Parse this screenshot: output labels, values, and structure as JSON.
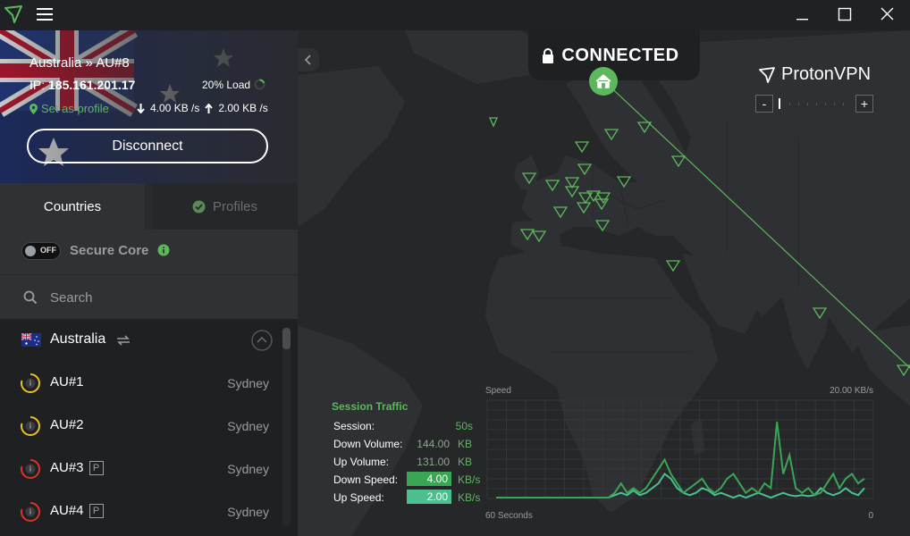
{
  "window": {
    "controls": [
      "minimize",
      "maximize",
      "close"
    ]
  },
  "connection": {
    "server": "Australia » AU#8",
    "ip_label": "IP:",
    "ip": "185.161.201.17",
    "load": "20% Load",
    "set_profile": "Set as profile",
    "down_speed": "4.00 KB /s",
    "up_speed": "2.00 KB /s",
    "disconnect_label": "Disconnect"
  },
  "tabs": {
    "countries": "Countries",
    "profiles": "Profiles"
  },
  "secure_core": {
    "toggle": "OFF",
    "label": "Secure Core"
  },
  "search": {
    "placeholder": "Search"
  },
  "country": {
    "name": "Australia"
  },
  "servers": [
    {
      "name": "AU#1",
      "city": "Sydney",
      "plus": false,
      "color": "#e5c12a"
    },
    {
      "name": "AU#2",
      "city": "Sydney",
      "plus": false,
      "color": "#e5c12a"
    },
    {
      "name": "AU#3",
      "city": "Sydney",
      "plus": true,
      "color": "#d9342b"
    },
    {
      "name": "AU#4",
      "city": "Sydney",
      "plus": true,
      "color": "#d9342b"
    }
  ],
  "plus_badge": "P",
  "status": {
    "text": "CONNECTED"
  },
  "brand": "ProtonVPN",
  "zoom": {
    "minus": "-",
    "plus": "+"
  },
  "session": {
    "title": "Session Traffic",
    "session_label": "Session:",
    "session_value": "50s",
    "down_volume_label": "Down Volume:",
    "down_volume_value": "144.00",
    "down_volume_unit": "KB",
    "up_volume_label": "Up Volume:",
    "up_volume_value": "131.00",
    "up_volume_unit": "KB",
    "down_speed_label": "Down Speed:",
    "down_speed_value": "4.00",
    "down_speed_unit": "KB/s",
    "up_speed_label": "Up Speed:",
    "up_speed_value": "2.00",
    "up_speed_unit": "KB/s"
  },
  "colors": {
    "accent": "#5cb85c",
    "up_speed_box": "#4bbf8f",
    "down_speed_box": "#3aa655"
  },
  "chart_data": {
    "type": "line",
    "title": "",
    "ylabel": "Speed",
    "ymax_label": "20.00  KB/s",
    "xlabel_left": "60 Seconds",
    "xlabel_right": "0",
    "ylim": [
      0,
      20
    ],
    "xlim": [
      60,
      0
    ],
    "series": [
      {
        "values": [
          0,
          0,
          0,
          0,
          0,
          0,
          0,
          0,
          0,
          0,
          0,
          0,
          0,
          0,
          0,
          0,
          0,
          0,
          0,
          0.5,
          1,
          0.5,
          1.5,
          0.5,
          1,
          2,
          3,
          5,
          4,
          2,
          1,
          0.5,
          1,
          2,
          1.5,
          0.5,
          1,
          0.5,
          0,
          0.5,
          0,
          0.5,
          1,
          0.5,
          0,
          0.5,
          1,
          0.5,
          0.3,
          0.5,
          0.3,
          0.5,
          2,
          1,
          0.5,
          1,
          2,
          1,
          0.5,
          2
        ]
      },
      {
        "values": [
          0,
          0,
          0,
          0,
          0,
          0,
          0,
          0,
          0,
          0,
          0,
          0,
          0,
          0,
          0,
          0,
          0,
          0,
          0,
          1,
          3,
          1,
          2,
          1,
          2,
          4,
          6,
          8,
          5,
          3,
          1,
          2,
          3,
          4,
          2,
          1,
          2,
          4,
          5,
          3,
          1,
          2,
          1,
          3,
          2,
          16,
          5,
          9,
          2,
          1,
          2,
          0.5,
          1,
          3,
          5,
          2,
          4,
          5,
          3,
          4
        ]
      }
    ]
  }
}
